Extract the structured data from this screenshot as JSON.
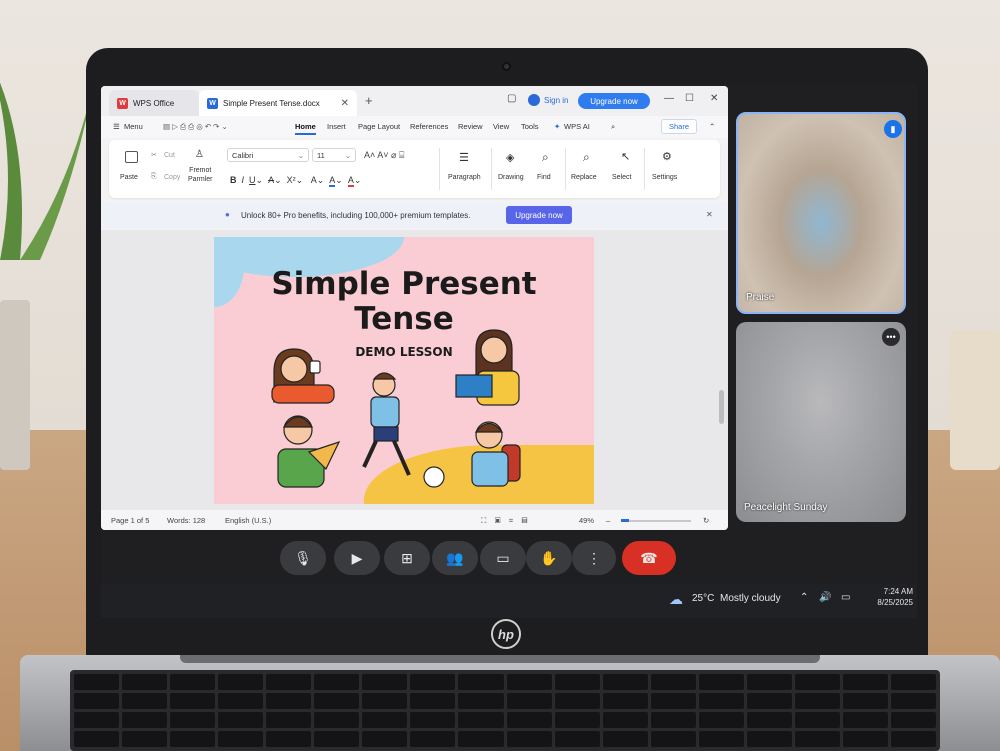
{
  "wps": {
    "tabs": {
      "home": "WPS Office",
      "doc": "Simple Present Tense.docx"
    },
    "sign_in": "Sign in",
    "upgrade_now": "Upgrade now",
    "menu": [
      "Menu",
      "Home",
      "Insert",
      "Page Layout",
      "References",
      "Review",
      "View",
      "Tools",
      "WPS AI"
    ],
    "share": "Share",
    "ribbon": {
      "paste": "Paste",
      "cut": "Cut",
      "copy": "Copy",
      "format_painter": "Fremot\nParmler",
      "font": "Calibri",
      "size": "11",
      "paragraph": "Paragraph",
      "drawing": "Drawing",
      "find": "Find",
      "replace": "Replace",
      "select": "Select",
      "settings": "Settings"
    },
    "banner": {
      "text": "Unlock 80+ Pro benefits, including 100,000+ premium templates.",
      "button": "Upgrade now"
    },
    "page": {
      "title_line1": "Simple Present",
      "title_line2": "Tense",
      "subtitle": "DEMO LESSON"
    },
    "status": {
      "page": "Page 1 of 5",
      "words": "Words: 128",
      "lang": "English (U.S.)",
      "zoom": "49%"
    }
  },
  "participants": [
    {
      "name": "Praise"
    },
    {
      "name": "Peacelight Sunday"
    }
  ],
  "taskbar": {
    "temp": "25°C",
    "weather": "Mostly cloudy",
    "time": "7:24 AM",
    "date": "8/25/2025"
  },
  "brand": "hp",
  "colors": {
    "accent": "#2f7bf0",
    "end_call": "#d93025",
    "banner_btn": "#5865e8"
  }
}
